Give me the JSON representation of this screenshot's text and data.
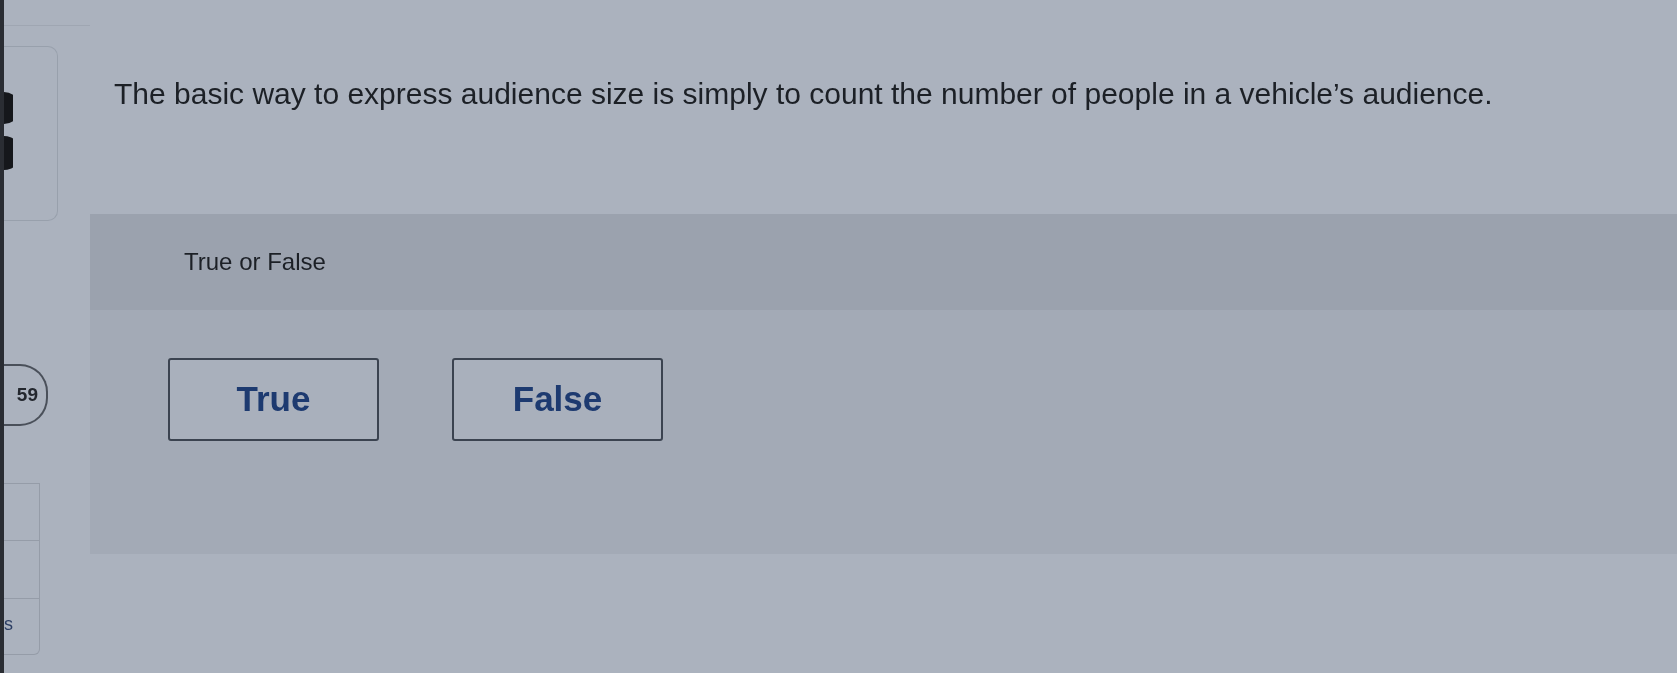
{
  "sidebar": {
    "timer_badge": "59",
    "table_cell_text": "s"
  },
  "question": {
    "text": "The basic way to express audience size is simply to count the number of people in a vehicle’s audience.",
    "prompt": "True or False",
    "options": [
      {
        "label": "True",
        "selected": false
      },
      {
        "label": "False",
        "selected": false
      }
    ]
  }
}
